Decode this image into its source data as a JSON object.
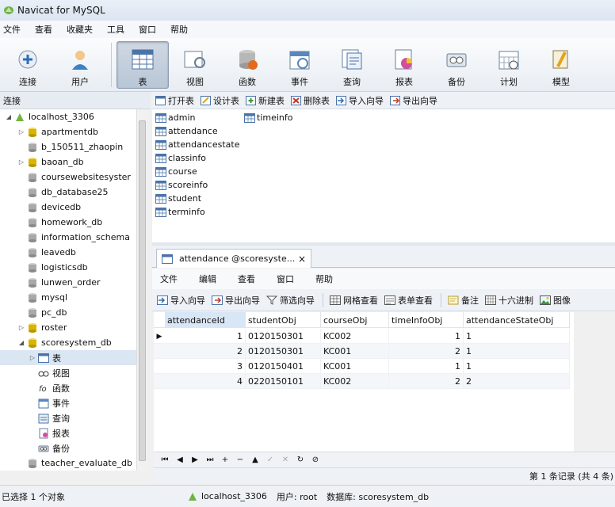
{
  "window": {
    "title": "Navicat for MySQL"
  },
  "menu": [
    "文件",
    "查看",
    "收藏夹",
    "工具",
    "窗口",
    "帮助"
  ],
  "toolbar": [
    {
      "label": "连接",
      "icon": "connect-icon"
    },
    {
      "label": "用户",
      "icon": "user-icon"
    },
    {
      "label": "表",
      "icon": "table-icon",
      "active": true
    },
    {
      "label": "视图",
      "icon": "view-icon"
    },
    {
      "label": "函数",
      "icon": "function-icon"
    },
    {
      "label": "事件",
      "icon": "event-icon"
    },
    {
      "label": "查询",
      "icon": "query-icon"
    },
    {
      "label": "报表",
      "icon": "report-icon"
    },
    {
      "label": "备份",
      "icon": "backup-icon"
    },
    {
      "label": "计划",
      "icon": "schedule-icon"
    },
    {
      "label": "模型",
      "icon": "model-icon"
    }
  ],
  "left_panel": {
    "header": "连接",
    "tree": [
      {
        "label": "localhost_3306",
        "level": 0,
        "expander": "◢",
        "type": "server"
      },
      {
        "label": "apartmentdb",
        "level": 1,
        "expander": "▷",
        "type": "db-open"
      },
      {
        "label": "b_150511_zhaopin",
        "level": 1,
        "expander": "",
        "type": "db"
      },
      {
        "label": "baoan_db",
        "level": 1,
        "expander": "▷",
        "type": "db-open"
      },
      {
        "label": "coursewebsitesyster",
        "level": 1,
        "expander": "",
        "type": "db"
      },
      {
        "label": "db_database25",
        "level": 1,
        "expander": "",
        "type": "db"
      },
      {
        "label": "devicedb",
        "level": 1,
        "expander": "",
        "type": "db"
      },
      {
        "label": "homework_db",
        "level": 1,
        "expander": "",
        "type": "db"
      },
      {
        "label": "information_schema",
        "level": 1,
        "expander": "",
        "type": "db"
      },
      {
        "label": "leavedb",
        "level": 1,
        "expander": "",
        "type": "db"
      },
      {
        "label": "logisticsdb",
        "level": 1,
        "expander": "",
        "type": "db"
      },
      {
        "label": "lunwen_order",
        "level": 1,
        "expander": "",
        "type": "db"
      },
      {
        "label": "mysql",
        "level": 1,
        "expander": "",
        "type": "db"
      },
      {
        "label": "pc_db",
        "level": 1,
        "expander": "",
        "type": "db"
      },
      {
        "label": "roster",
        "level": 1,
        "expander": "▷",
        "type": "db-open"
      },
      {
        "label": "scoresystem_db",
        "level": 1,
        "expander": "◢",
        "type": "db-open"
      },
      {
        "label": "表",
        "level": 2,
        "expander": "▷",
        "type": "tables",
        "selected": true
      },
      {
        "label": "视图",
        "level": 2,
        "expander": "",
        "type": "views"
      },
      {
        "label": "函数",
        "level": 2,
        "expander": "",
        "type": "functions"
      },
      {
        "label": "事件",
        "level": 2,
        "expander": "",
        "type": "events"
      },
      {
        "label": "查询",
        "level": 2,
        "expander": "",
        "type": "queries"
      },
      {
        "label": "报表",
        "level": 2,
        "expander": "",
        "type": "reports"
      },
      {
        "label": "备份",
        "level": 2,
        "expander": "",
        "type": "backups"
      },
      {
        "label": "teacher_evaluate_db",
        "level": 1,
        "expander": "",
        "type": "db"
      }
    ]
  },
  "object_toolbar": [
    "打开表",
    "设计表",
    "新建表",
    "删除表",
    "导入向导",
    "导出向导"
  ],
  "tables": [
    "admin",
    "attendance",
    "attendancestate",
    "classinfo",
    "course",
    "scoreinfo",
    "student",
    "terminfo",
    "timeinfo"
  ],
  "tab": {
    "label": "attendance @scoresyste...",
    "close": "×"
  },
  "inner_menu": [
    "文件",
    "编辑",
    "查看",
    "窗口",
    "帮助"
  ],
  "inner_toolbar": [
    "导入向导",
    "导出向导",
    "筛选向导",
    "网格查看",
    "表单查看",
    "备注",
    "十六进制",
    "图像"
  ],
  "grid": {
    "columns": [
      "attendanceId",
      "studentObj",
      "courseObj",
      "timeInfoObj",
      "attendanceStateObj"
    ],
    "rows": [
      [
        "1",
        "0120150301",
        "KC002",
        "1",
        "1"
      ],
      [
        "2",
        "0120150301",
        "KC001",
        "2",
        "1"
      ],
      [
        "3",
        "0120150401",
        "KC001",
        "1",
        "1"
      ],
      [
        "4",
        "0220150101",
        "KC002",
        "2",
        "2"
      ]
    ]
  },
  "nav_buttons": [
    "⏮",
    "◀",
    "▶",
    "⏭",
    "+",
    "−",
    "▲",
    "✓",
    "✕",
    "↻",
    "⊘"
  ],
  "record_info": "第 1 条记录 (共 4 条)",
  "status": {
    "selection": "已选择 1 个对象",
    "connection": "localhost_3306",
    "user": "用户: root",
    "database": "数据库: scoresystem_db"
  },
  "colors": {
    "accent": "#2f6db5",
    "db_open": "#d9b400",
    "db": "#8a8a8a"
  }
}
